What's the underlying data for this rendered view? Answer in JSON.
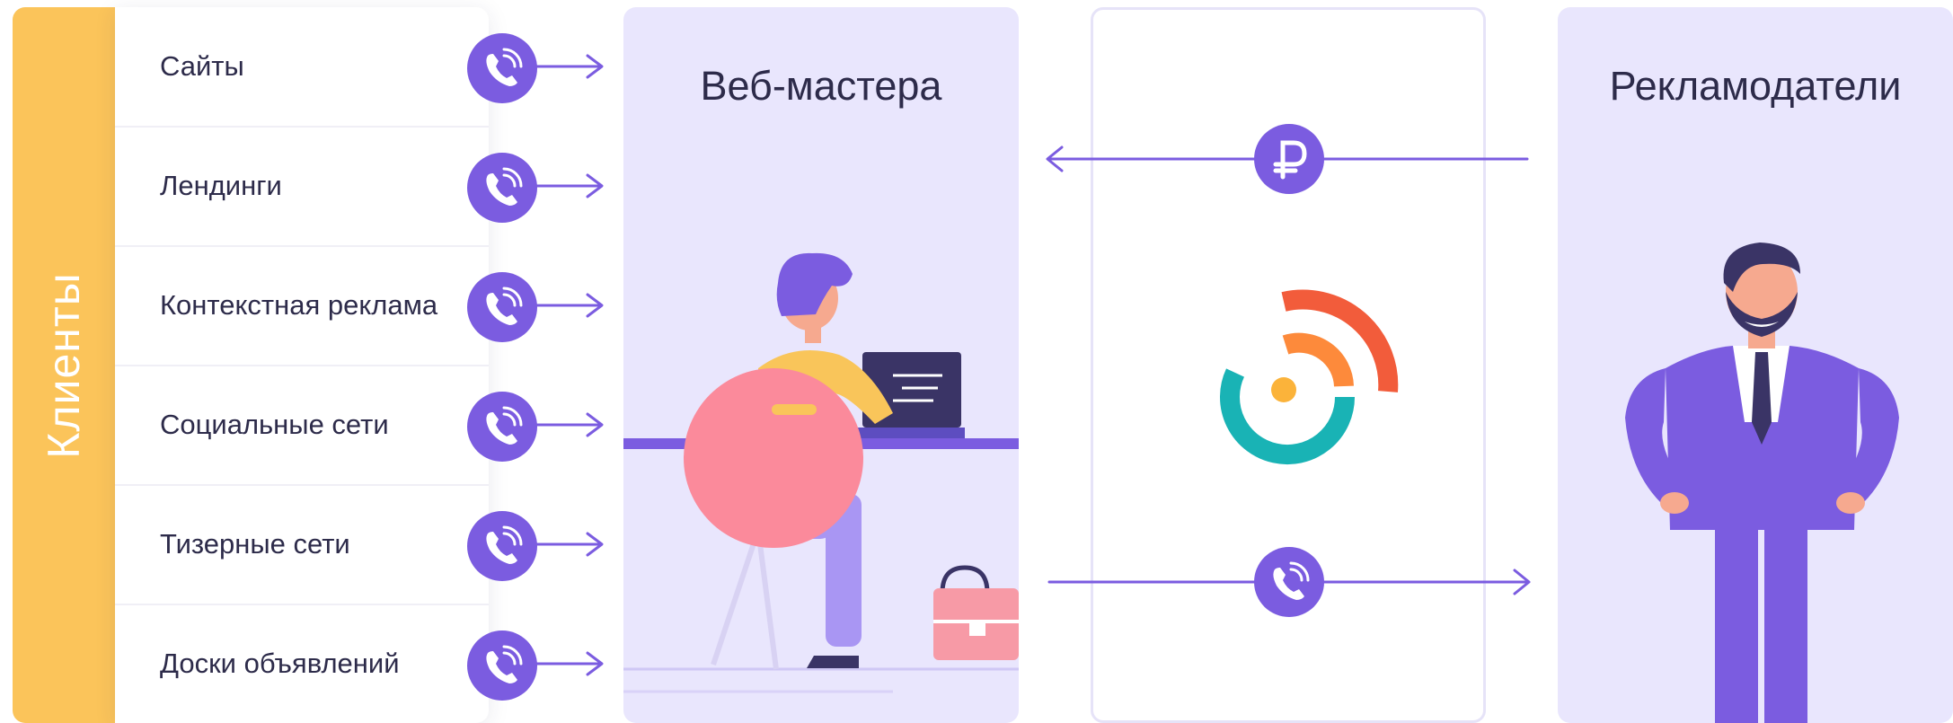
{
  "sidebar": {
    "label": "Клиенты"
  },
  "sources": [
    {
      "label": "Сайты",
      "icon": "phone-call-icon"
    },
    {
      "label": "Лендинги",
      "icon": "phone-call-icon"
    },
    {
      "label": "Контекстная реклама",
      "icon": "phone-call-icon"
    },
    {
      "label": "Социальные сети",
      "icon": "phone-call-icon"
    },
    {
      "label": "Тизерные сети",
      "icon": "phone-call-icon"
    },
    {
      "label": "Доски объявлений",
      "icon": "phone-call-icon"
    }
  ],
  "webmasters": {
    "title": "Веб-мастера"
  },
  "advertisers": {
    "title": "Рекламодатели"
  },
  "center": {
    "payment_icon": "ruble-icon",
    "call_icon": "phone-call-icon",
    "logo": "platform-logo"
  },
  "colors": {
    "accent": "#7b5ce0",
    "sidebar": "#fbc45a",
    "card": "#e9e6fd",
    "text": "#2d2b4a"
  }
}
